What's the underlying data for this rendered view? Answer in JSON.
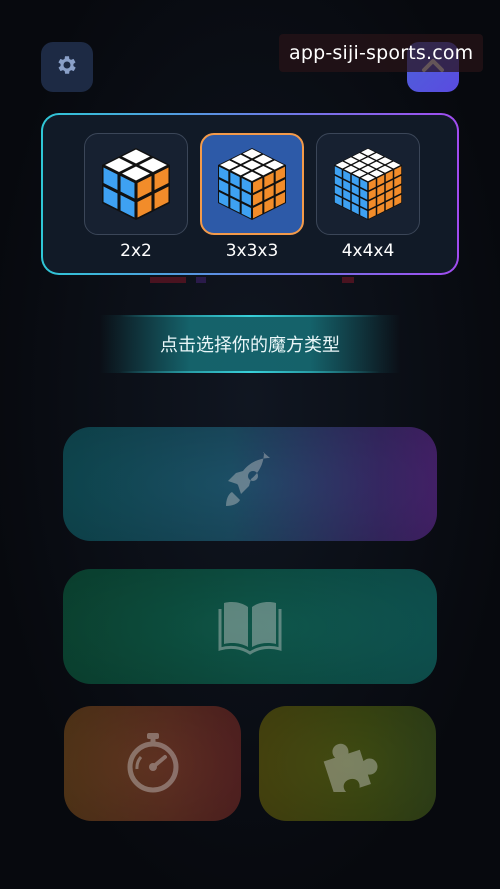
{
  "watermark": "app-siji-sports.com",
  "topbar": {
    "settings_icon": "gear-icon",
    "collapse_icon": "chevron-up-icon"
  },
  "picker": {
    "options": [
      {
        "label": "2x2",
        "grid": 2,
        "selected": false
      },
      {
        "label": "3x3x3",
        "grid": 3,
        "selected": true
      },
      {
        "label": "4x4x4",
        "grid": 4,
        "selected": false
      }
    ],
    "colors": {
      "top": "#ffffff",
      "left": "#3ea1f2",
      "right": "#f28c2a",
      "selected_border": "#f39a4a",
      "selected_bg": "#2d5aa8"
    }
  },
  "hint": "点击选择你的魔方类型",
  "cards": {
    "speed": {
      "icon": "rocket-icon"
    },
    "learn": {
      "icon": "open-book-icon"
    },
    "timer": {
      "icon": "stopwatch-icon"
    },
    "puzzle": {
      "icon": "puzzle-piece-icon"
    }
  }
}
